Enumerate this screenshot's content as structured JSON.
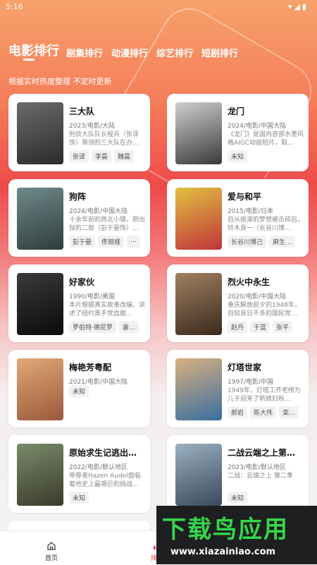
{
  "status_bar": {
    "time": "5:16",
    "icons": "▾◢▮"
  },
  "tabs": [
    {
      "label": "电影排行",
      "active": true
    },
    {
      "label": "剧集排行"
    },
    {
      "label": "动漫排行"
    },
    {
      "label": "综艺排行"
    },
    {
      "label": "短剧排行"
    }
  ],
  "subtitle": "根据实时热度整理 不定时更新",
  "cards": [
    {
      "title": "三大队",
      "meta": "2023/电影/大陆",
      "desc": "刑侦大队队长程兵（张译饰）带领的三大队在办…",
      "chips": [
        "张译",
        "李晨",
        "魏晨"
      ],
      "poster": [
        "#6b6b6b",
        "#2b2b2b"
      ]
    },
    {
      "title": "龙门",
      "meta": "2024/电影/中国大陆",
      "desc": "《龙门》是国内首部水墨风格AIGC动画短片，取…",
      "chips": [
        "未知"
      ],
      "poster": [
        "#cfcfcf",
        "#3a3a3a"
      ]
    },
    {
      "title": "狗阵",
      "meta": "2024/电影/中国大陆",
      "desc": "十余年前的西北小镇，刚出狱的二郎（彭于晏饰）…",
      "chips": [
        "彭于晏",
        "佟丽娅",
        "…"
      ],
      "poster": [
        "#6f8a8a",
        "#2e3c3c"
      ]
    },
    {
      "title": "爱与和平",
      "meta": "2015/电影/日本",
      "desc": "自从摇滚的梦想被击碎后，铃木良一（长谷川博…",
      "chips": [
        "长谷川博己",
        "麻生…"
      ],
      "poster": [
        "#e0c040",
        "#c0343c"
      ]
    },
    {
      "title": "好家伙",
      "meta": "1990/电影/美国",
      "desc": "本片根据真实故事改编，讲述了纽约黑手党血腥…",
      "chips": [
        "罗伯特·德尼罗",
        "雷…"
      ],
      "poster": [
        "#3a3a3a",
        "#0a0a0a"
      ]
    },
    {
      "title": "烈火中永生",
      "meta": "2020/电影/中国大陆",
      "desc": "重庆解放前夕的1948年，自知良日不多的国民党…",
      "chips": [
        "赵丹",
        "于蓝",
        "张平"
      ],
      "poster": [
        "#a08060",
        "#3a2a1e"
      ]
    },
    {
      "title": "梅艳芳粤配",
      "meta": "2021/电影/中国大陆",
      "desc": "",
      "chips": [
        "未知"
      ],
      "poster": [
        "#e0a878",
        "#9a5a3a"
      ]
    },
    {
      "title": "灯塔世家",
      "meta": "1997/电影/中国",
      "desc": "1949年，灯塔工齐老榜为儿子迎来了新媳妇秋…",
      "chips": [
        "郝岩",
        "陈大伟",
        "栾…"
      ],
      "poster": [
        "#d8b080",
        "#3a6ea0"
      ]
    },
    {
      "title": "原始求生记逃出…",
      "meta": "2022/电影/默认地区",
      "desc": "帝荐者Hazen Audel面临着他史上最艰巨的挑战…",
      "chips": [
        "未知"
      ],
      "poster": [
        "#7a8a6a",
        "#3a3a2a"
      ]
    },
    {
      "title": "二战云端之上第…",
      "meta": "2023/电影/默认地区",
      "desc": "二战：云端之上 第二季",
      "chips": [
        "未知"
      ],
      "poster": [
        "#9ab0c0",
        "#3a4a5a"
      ]
    }
  ],
  "navbar": {
    "home_label": "首页",
    "rank_label": "排行"
  },
  "watermark": {
    "big": "下载鸟应用",
    "small": "www.xiazainiao.com"
  },
  "colors": {
    "accent": "#e8323c",
    "header_top": "#f7a26b",
    "header_mid": "#ee4b4a"
  }
}
